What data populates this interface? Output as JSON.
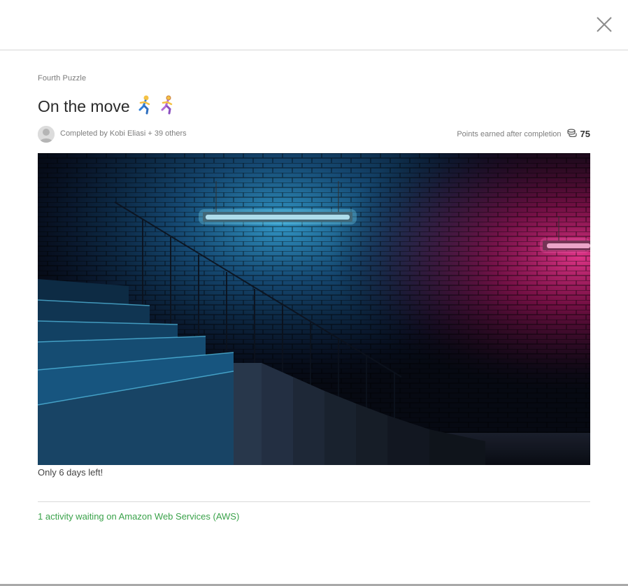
{
  "header": {
    "close_icon": "close-icon"
  },
  "puzzle": {
    "subtitle": "Fourth Puzzle",
    "title": "On the move",
    "title_emoji": "🏃🏃‍♀️",
    "completed_text": "Completed by Kobi Eliasi + 39 others",
    "points_label": "Points earned after completion",
    "points_icon": "coins-icon",
    "points_value": "75",
    "image_description_icon": "hero-image",
    "days_left": "Only 6 days left!",
    "activity_link": "1 activity waiting on Amazon Web Services (AWS)"
  },
  "colors": {
    "link": "#3aa24a",
    "neon_blue": "#5fd6ff",
    "neon_pink": "#ff4fa8"
  }
}
